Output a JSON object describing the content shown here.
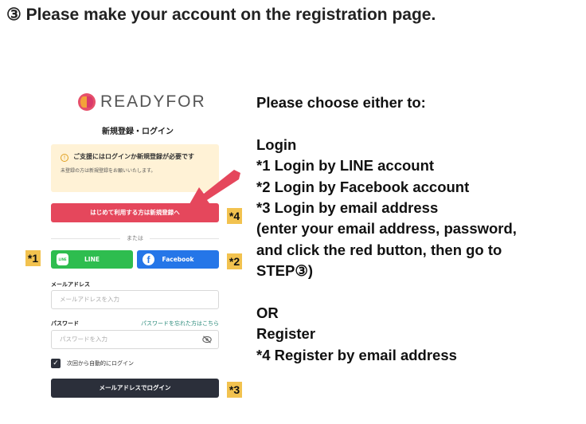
{
  "heading": "③ Please make your account on the registration page.",
  "screenshot": {
    "logo_text": "READYFOR",
    "page_title": "新規登録・ログイン",
    "notice": {
      "icon": "info-icon",
      "title": "ご支援にはログインか新規登録が必要です",
      "subtitle": "未登録の方は新規登録をお願いいたします。"
    },
    "register_button": "はじめて利用する方は新規登録へ",
    "divider_text": "または",
    "line_button": {
      "label": "LINE",
      "icon_text": "LINE",
      "color": "#2ebd4f"
    },
    "facebook_button": {
      "label": "Facebook",
      "icon_text": "f",
      "color": "#2576e8"
    },
    "email": {
      "label": "メールアドレス",
      "placeholder": "メールアドレスを入力"
    },
    "password": {
      "label": "パスワード",
      "placeholder": "パスワードを入力",
      "forgot_link": "パスワードを忘れた方はこちら"
    },
    "remember": {
      "label": "次回から自動的にログイン",
      "checked": true
    },
    "login_button": "メールアドレスでログイン"
  },
  "tags": {
    "t1": "*1",
    "t2": "*2",
    "t3": "*3",
    "t4": "*4"
  },
  "instructions": {
    "lines": [
      "Please choose either to:",
      "",
      "Login",
      "*1 Login by LINE account",
      "*2 Login by Facebook account",
      "*3 Login by email address",
      "(enter your email address, password,",
      "and click the red button, then go to",
      "STEP③)",
      "",
      "OR",
      "Register",
      "*4  Register by email address"
    ]
  },
  "colors": {
    "register_button": "#e5475c",
    "arrow": "#e5475c",
    "tag": "#f2c24f",
    "notice_bg": "#fff2d6",
    "login_button": "#2b2f3a"
  }
}
